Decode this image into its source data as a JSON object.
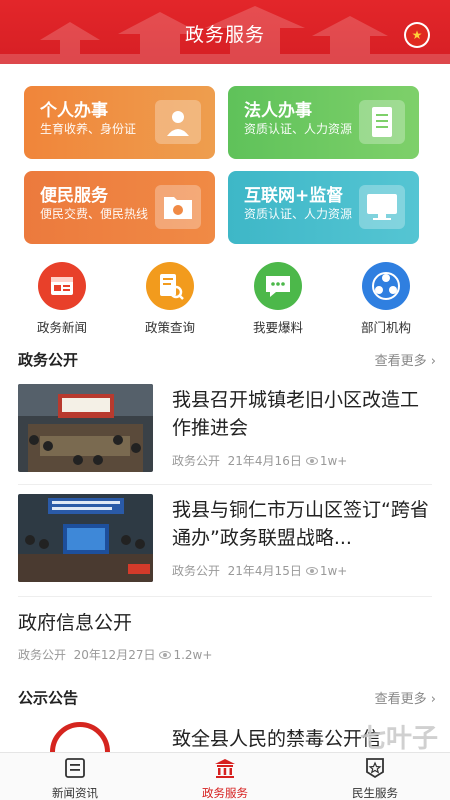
{
  "header": {
    "title": "政务服务"
  },
  "service_cards": [
    {
      "title": "个人办事",
      "subtitle": "生育收养、身份证"
    },
    {
      "title": "法人办事",
      "subtitle": "资质认证、人力资源"
    },
    {
      "title": "便民服务",
      "subtitle": "便民交费、便民热线"
    },
    {
      "title": "互联网+监督",
      "subtitle": "资质认证、人力资源"
    }
  ],
  "quick_links": [
    {
      "label": "政务新闻",
      "icon": "news-icon",
      "color": "#e8402a"
    },
    {
      "label": "政策查询",
      "icon": "policy-search-icon",
      "color": "#f29b1d"
    },
    {
      "label": "我要爆料",
      "icon": "chat-icon",
      "color": "#4cb84a"
    },
    {
      "label": "部门机构",
      "icon": "org-icon",
      "color": "#2f7fe0"
    }
  ],
  "sections": {
    "gov_open": {
      "title": "政务公开",
      "more": "查看更多"
    },
    "notice": {
      "title": "公示公告",
      "more": "查看更多"
    }
  },
  "news": [
    {
      "title": "我县召开城镇老旧小区改造工作推进会",
      "category": "政务公开",
      "date": "21年4月16日",
      "views": "1w+"
    },
    {
      "title": "我县与铜仁市万山区签订“跨省通办”政务联盟战略...",
      "category": "政务公开",
      "date": "21年4月15日",
      "views": "1w+"
    },
    {
      "title": "政府信息公开",
      "category": "政务公开",
      "date": "20年12月27日",
      "views": "1.2w+"
    }
  ],
  "notice_item": {
    "title": "致全县人民的禁毒公开信"
  },
  "tabbar": [
    {
      "label": "新闻资讯",
      "icon": "news-tab-icon"
    },
    {
      "label": "政务服务",
      "icon": "gov-service-tab-icon"
    },
    {
      "label": "民生服务",
      "icon": "livelihood-tab-icon"
    }
  ],
  "watermark": "七叶子",
  "colors": {
    "brand_red": "#d6201f",
    "accent_orange": "#f0853a",
    "accent_green": "#5fc25a",
    "accent_teal": "#3eb7c7"
  }
}
